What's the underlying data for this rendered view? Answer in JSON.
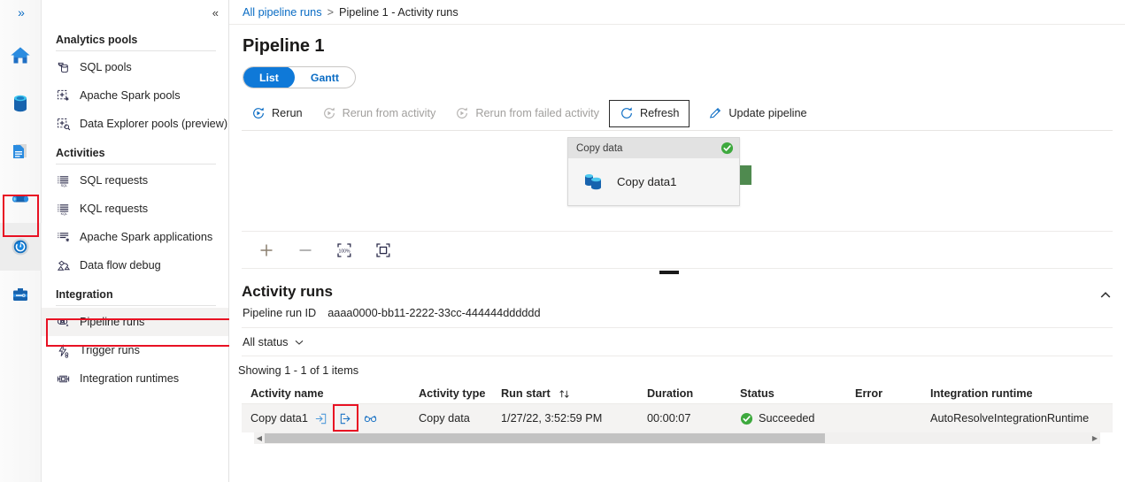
{
  "rail": {
    "expand_label": "»",
    "items": [
      {
        "name": "home",
        "label": "Home"
      },
      {
        "name": "data",
        "label": "Data"
      },
      {
        "name": "develop",
        "label": "Develop"
      },
      {
        "name": "integrate",
        "label": "Integrate"
      },
      {
        "name": "monitor",
        "label": "Monitor",
        "selected": true,
        "highlighted": true
      },
      {
        "name": "manage",
        "label": "Manage"
      }
    ]
  },
  "sidebar": {
    "collapse_label": "«",
    "groups": [
      {
        "title": "Analytics pools",
        "items": [
          {
            "label": "SQL pools",
            "icon": "sql-pools-icon"
          },
          {
            "label": "Apache Spark pools",
            "icon": "spark-pools-icon"
          },
          {
            "label": "Data Explorer pools (preview)",
            "icon": "data-explorer-pools-icon"
          }
        ]
      },
      {
        "title": "Activities",
        "items": [
          {
            "label": "SQL requests",
            "icon": "sql-requests-icon"
          },
          {
            "label": "KQL requests",
            "icon": "kql-requests-icon"
          },
          {
            "label": "Apache Spark applications",
            "icon": "spark-applications-icon"
          },
          {
            "label": "Data flow debug",
            "icon": "data-flow-debug-icon"
          }
        ]
      },
      {
        "title": "Integration",
        "items": [
          {
            "label": "Pipeline runs",
            "icon": "pipeline-runs-icon",
            "selected": true,
            "highlighted": true
          },
          {
            "label": "Trigger runs",
            "icon": "trigger-runs-icon"
          },
          {
            "label": "Integration runtimes",
            "icon": "integration-runtimes-icon"
          }
        ]
      }
    ]
  },
  "breadcrumb": {
    "root": "All pipeline runs",
    "separator": ">",
    "current": "Pipeline 1 - Activity runs"
  },
  "page": {
    "title": "Pipeline 1"
  },
  "view_toggle": {
    "list": "List",
    "gantt": "Gantt",
    "active": "List"
  },
  "toolbar": {
    "rerun": "Rerun",
    "rerun_from_activity": "Rerun from activity",
    "rerun_from_failed": "Rerun from failed activity",
    "refresh": "Refresh",
    "update_pipeline": "Update pipeline"
  },
  "canvas": {
    "node": {
      "header": "Copy data",
      "label": "Copy data1",
      "status": "Succeeded"
    },
    "zoom_tools": {
      "zoom_in": "+",
      "zoom_out": "−",
      "zoom_level": "100%",
      "fit_to_screen": "Fit to screen"
    }
  },
  "activity_runs": {
    "title": "Activity runs",
    "run_id_label": "Pipeline run ID",
    "run_id_value": "aaaa0000-bb11-2222-33cc-444444dddddd",
    "status_filter": "All status",
    "showing": "Showing 1 - 1 of 1 items",
    "columns": [
      "Activity name",
      "Activity type",
      "Run start",
      "Duration",
      "Status",
      "Error",
      "Integration runtime"
    ],
    "rows": [
      {
        "activity_name": "Copy data1",
        "activity_type": "Copy data",
        "run_start": "1/27/22, 3:52:59 PM",
        "duration": "00:00:07",
        "status": "Succeeded",
        "error": "",
        "integration_runtime": "AutoResolveIntegrationRuntime",
        "actions": [
          "input-icon",
          "output-icon",
          "details-icon"
        ],
        "highlighted_action": "output-icon"
      }
    ]
  },
  "colors": {
    "accent": "#0f79d8",
    "link": "#0a6cc4",
    "success": "#107c10",
    "annotation": "#e81123",
    "node_green": "#4f8a4f"
  }
}
